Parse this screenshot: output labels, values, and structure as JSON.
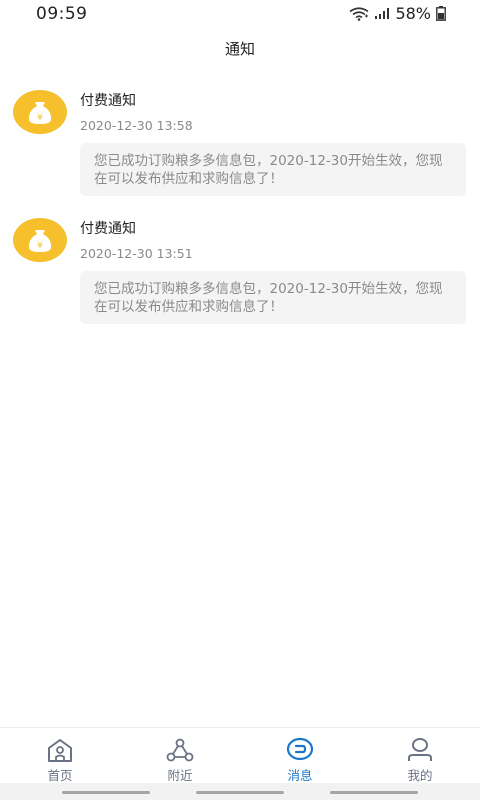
{
  "status_bar": {
    "time": "09:59",
    "battery": "58%",
    "icons": [
      "wifi-icon",
      "signal-icon",
      "battery-icon"
    ]
  },
  "header": {
    "title": "通知"
  },
  "notifications": [
    {
      "title": "付费通知",
      "time": "2020-12-30 13:58",
      "body": "您已成功订购粮多多信息包，2020-12-30开始生效，您现在可以发布供应和求购信息了！",
      "icon": "money-bag-icon"
    },
    {
      "title": "付费通知",
      "time": "2020-12-30 13:51",
      "body": "您已成功订购粮多多信息包，2020-12-30开始生效，您现在可以发布供应和求购信息了！",
      "icon": "money-bag-icon"
    }
  ],
  "tabs": [
    {
      "label": "首页",
      "icon": "home-icon",
      "active": false
    },
    {
      "label": "附近",
      "icon": "nearby-icon",
      "active": false
    },
    {
      "label": "消息",
      "icon": "message-icon",
      "active": true
    },
    {
      "label": "我的",
      "icon": "profile-icon",
      "active": false
    }
  ],
  "colors": {
    "accent": "#1b78c9",
    "tab_inactive": "#6a7284",
    "avatar_gold": "#f6c02c",
    "bubble_bg": "#f4f4f4"
  }
}
